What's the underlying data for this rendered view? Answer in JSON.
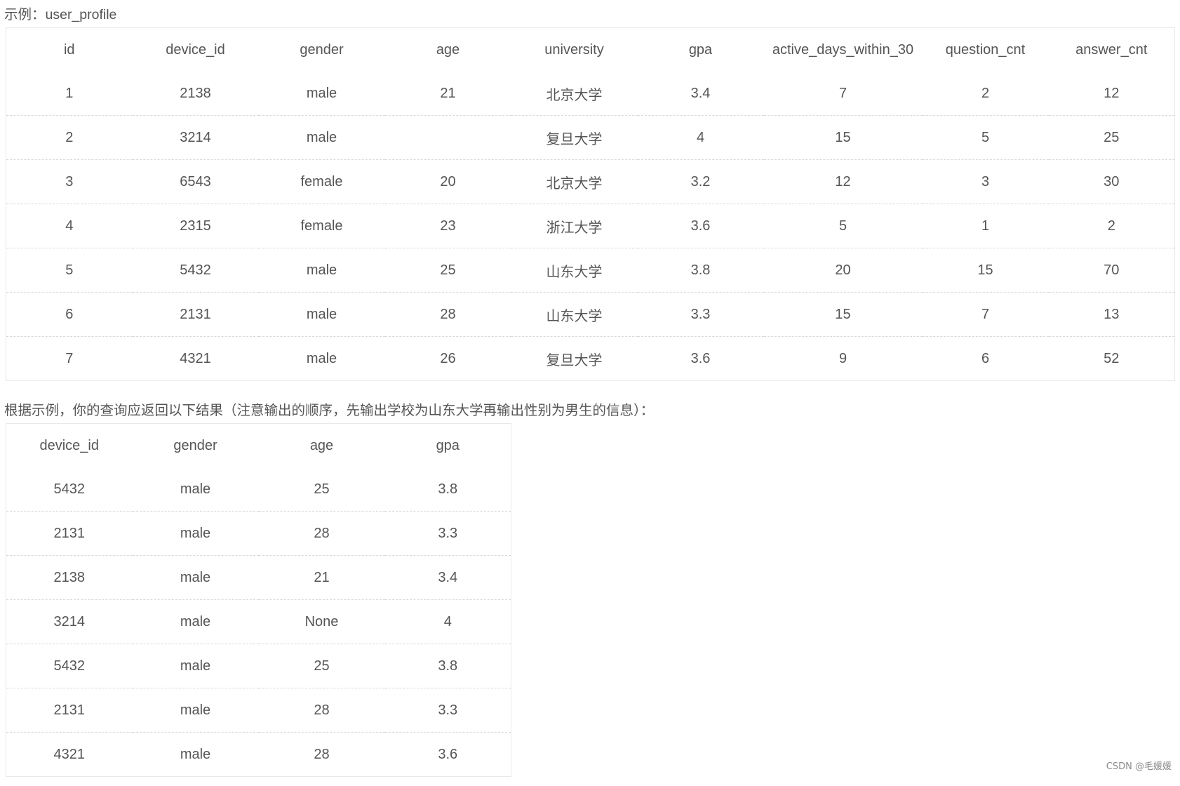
{
  "section1": {
    "caption": "示例：user_profile",
    "columns": [
      "id",
      "device_id",
      "gender",
      "age",
      "university",
      "gpa",
      "active_days_within_30",
      "question_cnt",
      "answer_cnt"
    ],
    "rows": [
      [
        "1",
        "2138",
        "male",
        "21",
        "北京大学",
        "3.4",
        "7",
        "2",
        "12"
      ],
      [
        "2",
        "3214",
        "male",
        "",
        "复旦大学",
        "4",
        "15",
        "5",
        "25"
      ],
      [
        "3",
        "6543",
        "female",
        "20",
        "北京大学",
        "3.2",
        "12",
        "3",
        "30"
      ],
      [
        "4",
        "2315",
        "female",
        "23",
        "浙江大学",
        "3.6",
        "5",
        "1",
        "2"
      ],
      [
        "5",
        "5432",
        "male",
        "25",
        "山东大学",
        "3.8",
        "20",
        "15",
        "70"
      ],
      [
        "6",
        "2131",
        "male",
        "28",
        "山东大学",
        "3.3",
        "15",
        "7",
        "13"
      ],
      [
        "7",
        "4321",
        "male",
        "26",
        "复旦大学",
        "3.6",
        "9",
        "6",
        "52"
      ]
    ]
  },
  "section2": {
    "caption": "根据示例，你的查询应返回以下结果（注意输出的顺序，先输出学校为山东大学再输出性别为男生的信息）：",
    "columns": [
      "device_id",
      "gender",
      "age",
      "gpa"
    ],
    "rows": [
      [
        "5432",
        "male",
        "25",
        "3.8"
      ],
      [
        "2131",
        "male",
        "28",
        "3.3"
      ],
      [
        "2138",
        "male",
        "21",
        "3.4"
      ],
      [
        "3214",
        "male",
        "None",
        "4"
      ],
      [
        "5432",
        "male",
        "25",
        "3.8"
      ],
      [
        "2131",
        "male",
        "28",
        "3.3"
      ],
      [
        "4321",
        "male",
        "28",
        "3.6"
      ]
    ]
  },
  "watermark": "CSDN @毛媛媛"
}
